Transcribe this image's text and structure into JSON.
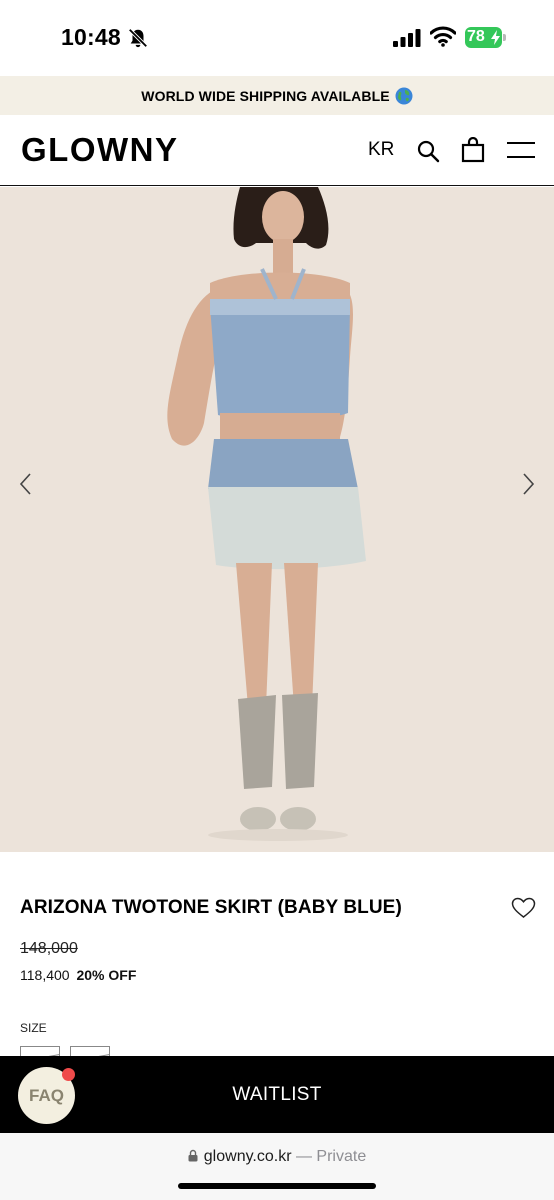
{
  "status_bar": {
    "time": "10:48",
    "battery_level": "78",
    "battery_color": "#34c759"
  },
  "promo": {
    "text": "WORLD WIDE SHIPPING AVAILABLE",
    "icon": "globe-icon"
  },
  "header": {
    "logo": "GLOWNY",
    "language": "KR",
    "icons": [
      "search-icon",
      "shopping-bag-icon",
      "menu-icon"
    ]
  },
  "gallery": {
    "image_alt": "Model wearing denim tube top and two-tone denim mini skirt",
    "background_color": "#ece3da"
  },
  "product": {
    "title": "ARIZONA TWOTONE SKIRT (BABY BLUE)",
    "price_original": "148,000",
    "price_sale": "118,400",
    "discount": "20% OFF",
    "size_label": "SIZE"
  },
  "actions": {
    "waitlist_label": "WAITLIST",
    "faq_label": "FAQ"
  },
  "browser": {
    "domain": "glowny.co.kr",
    "mode": "— Private"
  }
}
